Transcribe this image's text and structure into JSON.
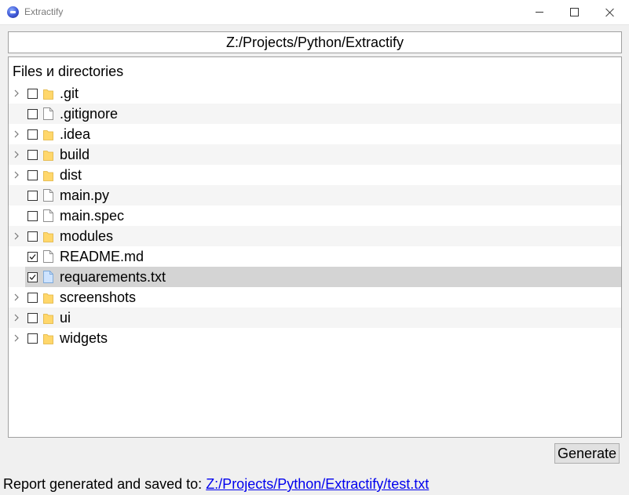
{
  "window": {
    "title": "Extractify",
    "controls": [
      "minimize",
      "maximize",
      "close"
    ]
  },
  "path_field": {
    "value": "Z:/Projects/Python/Extractify"
  },
  "tree": {
    "header": "Files и directories",
    "items": [
      {
        "name": ".git",
        "type": "folder",
        "expandable": true,
        "checked": false,
        "selected": false
      },
      {
        "name": ".gitignore",
        "type": "file",
        "expandable": false,
        "checked": false,
        "selected": false
      },
      {
        "name": ".idea",
        "type": "folder",
        "expandable": true,
        "checked": false,
        "selected": false
      },
      {
        "name": "build",
        "type": "folder",
        "expandable": true,
        "checked": false,
        "selected": false
      },
      {
        "name": "dist",
        "type": "folder",
        "expandable": true,
        "checked": false,
        "selected": false
      },
      {
        "name": "main.py",
        "type": "file",
        "expandable": false,
        "checked": false,
        "selected": false
      },
      {
        "name": "main.spec",
        "type": "file",
        "expandable": false,
        "checked": false,
        "selected": false
      },
      {
        "name": "modules",
        "type": "folder",
        "expandable": true,
        "checked": false,
        "selected": false
      },
      {
        "name": "README.md",
        "type": "file",
        "expandable": false,
        "checked": true,
        "selected": false
      },
      {
        "name": "requarements.txt",
        "type": "file",
        "expandable": false,
        "checked": true,
        "selected": true
      },
      {
        "name": "screenshots",
        "type": "folder",
        "expandable": true,
        "checked": false,
        "selected": false
      },
      {
        "name": "ui",
        "type": "folder",
        "expandable": true,
        "checked": false,
        "selected": false
      },
      {
        "name": "widgets",
        "type": "folder",
        "expandable": true,
        "checked": false,
        "selected": false
      }
    ]
  },
  "generate_button": {
    "label": "Generate"
  },
  "status": {
    "text": "Report generated and saved to: ",
    "link": "Z:/Projects/Python/Extractify/test.txt"
  },
  "colors": {
    "folder": "#ffd76b",
    "file_selected": "#cde3ff",
    "selected_row": "#d4d4d4",
    "link": "#0000ee"
  }
}
